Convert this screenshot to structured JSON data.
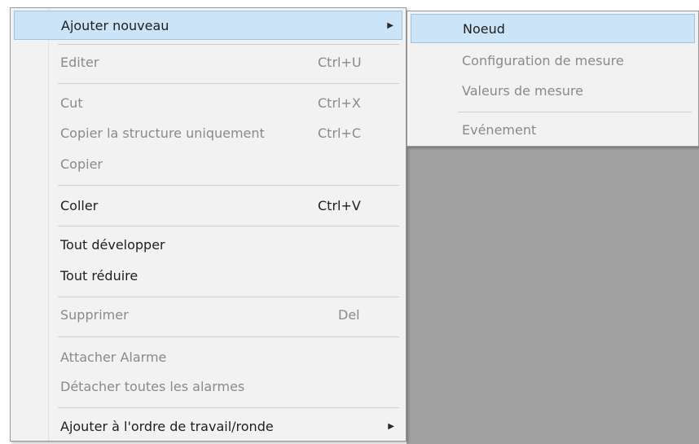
{
  "context_menu": {
    "items": [
      {
        "label": "Ajouter nouveau",
        "shortcut": "",
        "submenu_arrow": "▶"
      },
      {
        "label": "Editer",
        "shortcut": "Ctrl+U"
      },
      {
        "label": "Cut",
        "shortcut": "Ctrl+X"
      },
      {
        "label": "Copier la structure uniquement",
        "shortcut": "Ctrl+C"
      },
      {
        "label": "Copier",
        "shortcut": ""
      },
      {
        "label": "Coller",
        "shortcut": "Ctrl+V"
      },
      {
        "label": "Tout développer",
        "shortcut": ""
      },
      {
        "label": "Tout réduire",
        "shortcut": ""
      },
      {
        "label": "Supprimer",
        "shortcut": "Del"
      },
      {
        "label": "Attacher Alarme",
        "shortcut": ""
      },
      {
        "label": "Détacher toutes les alarmes",
        "shortcut": ""
      },
      {
        "label": "Ajouter à l'ordre de travail/ronde",
        "shortcut": "",
        "submenu_arrow": "▶"
      }
    ]
  },
  "submenu": {
    "items": [
      {
        "label": "Noeud"
      },
      {
        "label": "Configuration de mesure"
      },
      {
        "label": "Valeurs de mesure"
      },
      {
        "label": "Evénement"
      }
    ]
  },
  "colors": {
    "menu_background": "#f2f2f2",
    "highlight": "#cce4f7",
    "highlight_border": "#9ec4e6",
    "disabled_text": "#8a8a8a",
    "backdrop": "#a0a0a0"
  }
}
